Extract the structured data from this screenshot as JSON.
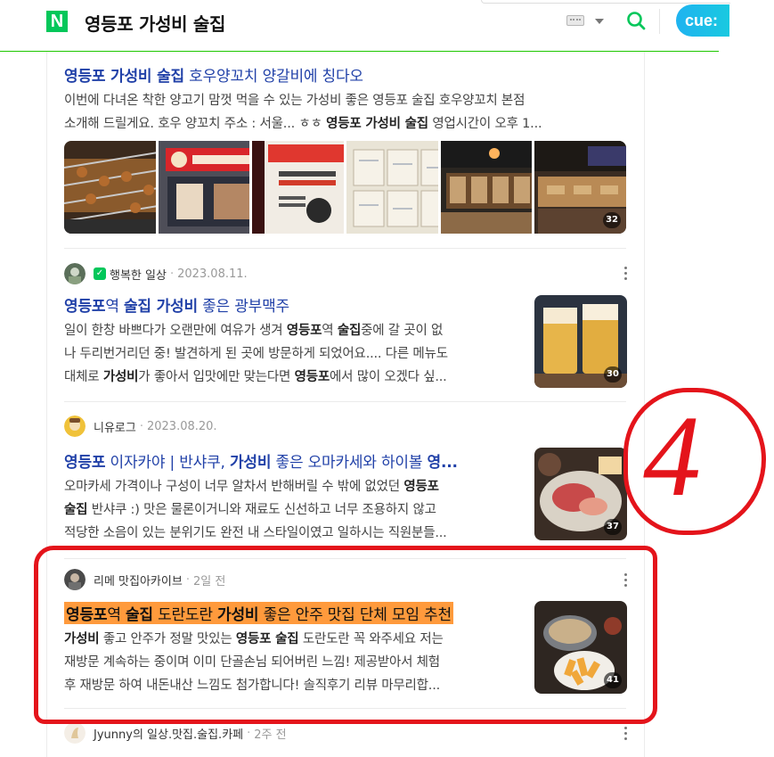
{
  "header": {
    "logo": "N",
    "query": "영등포 가성비 술집",
    "cue_label": "cue:"
  },
  "results": [
    {
      "title_parts": [
        {
          "text": "영등포 가성비 술집",
          "bold": true
        },
        {
          "text": " 호우양꼬치 양갈비에 칭다오",
          "bold": false
        }
      ],
      "desc_lines": [
        [
          {
            "t": "이번에 다녀온 착한 양고기 맘껏 먹을 수 있는 가성비 좋은 영등포 술집 호우양꼬치 본점",
            "b": false
          }
        ],
        [
          {
            "t": "소개해 드릴게요. 호우 양꼬치 주소 : 서울... ㅎㅎ ",
            "b": false
          },
          {
            "t": "영등포 가성비 술집",
            "b": true
          },
          {
            "t": " 영업시간이 오후 1...",
            "b": false
          }
        ]
      ],
      "photo_count": "32"
    },
    {
      "author": "행복한 일상",
      "date": "2023.08.11.",
      "title_parts": [
        {
          "text": "영등포",
          "bold": true
        },
        {
          "text": "역 ",
          "bold": false
        },
        {
          "text": "술집 가성비",
          "bold": true
        },
        {
          "text": " 좋은 광부맥주",
          "bold": false
        }
      ],
      "desc_lines": [
        [
          {
            "t": "일이 한창 바쁘다가 오랜만에 여유가 생겨 ",
            "b": false
          },
          {
            "t": "영등포",
            "b": true
          },
          {
            "t": "역 ",
            "b": false
          },
          {
            "t": "술집",
            "b": true
          },
          {
            "t": "중에 갈 곳이 없",
            "b": false
          }
        ],
        [
          {
            "t": "나 두리번거리던 중! 발견하게 된 곳에 방문하게 되었어요.... 다른 메뉴도",
            "b": false
          }
        ],
        [
          {
            "t": "대체로 ",
            "b": false
          },
          {
            "t": "가성비",
            "b": true
          },
          {
            "t": "가 좋아서 입맛에만 맞는다면 ",
            "b": false
          },
          {
            "t": "영등포",
            "b": true
          },
          {
            "t": "에서 많이 오겠다 싶...",
            "b": false
          }
        ]
      ],
      "photo_count": "30"
    },
    {
      "author": "니유로그",
      "date": "2023.08.20.",
      "title_parts": [
        {
          "text": "영등포",
          "bold": true
        },
        {
          "text": " 이자카야 | 반샤쿠, ",
          "bold": false
        },
        {
          "text": "가성비",
          "bold": true
        },
        {
          "text": " 좋은 오마카세와 하이볼 ",
          "bold": false
        },
        {
          "text": "영...",
          "bold": true
        }
      ],
      "desc_lines": [
        [
          {
            "t": "오마카세 가격이나 구성이 너무 알차서 반해버릴 수 밖에 없었던 ",
            "b": false
          },
          {
            "t": "영등포",
            "b": true
          }
        ],
        [
          {
            "t": "술집",
            "b": true
          },
          {
            "t": " 반샤쿠 :) 맛은 물론이거니와 재료도 신선하고 너무 조용하지 않고",
            "b": false
          }
        ],
        [
          {
            "t": "적당한 소음이 있는 분위기도 완전 내 스타일이였고 일하시는 직원분들...",
            "b": false
          }
        ]
      ],
      "photo_count": "37"
    },
    {
      "author": "리메 맛집아카이브",
      "date": "2일 전",
      "title_parts": [
        {
          "text": "영등포",
          "bold": true
        },
        {
          "text": "역 ",
          "bold": false
        },
        {
          "text": "술집",
          "bold": true
        },
        {
          "text": " 도란도란 ",
          "bold": false
        },
        {
          "text": "가성비",
          "bold": true
        },
        {
          "text": " 좋은 안주 맛집 단체 모임 추천",
          "bold": false
        }
      ],
      "desc_lines": [
        [
          {
            "t": "가성비",
            "b": true
          },
          {
            "t": " 좋고 안주가 정말 맛있는 ",
            "b": false
          },
          {
            "t": "영등포 술집",
            "b": true
          },
          {
            "t": " 도란도란 꼭 와주세요 저는",
            "b": false
          }
        ],
        [
          {
            "t": "재방문 계속하는 중이며 이미 단골손님 되어버린 느낌! 제공받아서 체험",
            "b": false
          }
        ],
        [
          {
            "t": "후 재방문 하여 내돈내산 느낌도 첨가합니다! 솔직후기 리뷰 마무리합...",
            "b": false
          }
        ]
      ],
      "photo_count": "41"
    },
    {
      "author": "Jyunny의 일상.맛집.술집.카페",
      "date": "2주 전"
    }
  ],
  "annotation": {
    "label": "4",
    "color": "#e4141b"
  },
  "colors": {
    "brand_green": "#03c75a",
    "title_blue": "#2141a8",
    "highlight_orange": "#ff9a3c"
  }
}
